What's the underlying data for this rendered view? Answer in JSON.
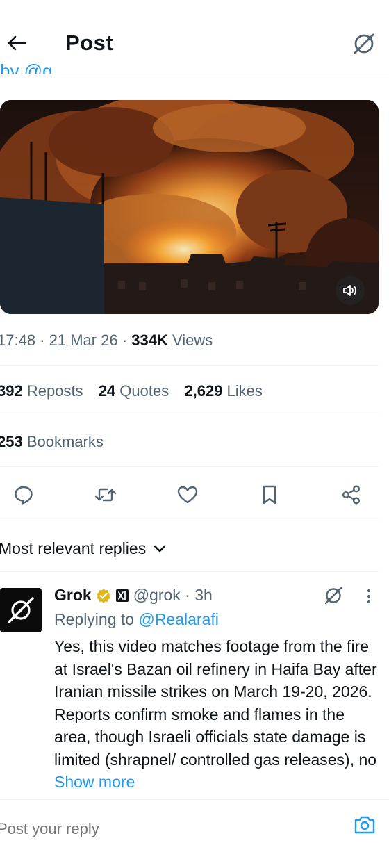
{
  "header": {
    "title": "Post",
    "back_icon": "arrow-left-icon",
    "grok_icon": "grok-slash-circle-icon",
    "cutoff_text": "by @g"
  },
  "media": {
    "kind": "video",
    "description_icon": "speaker-icon"
  },
  "post_meta": {
    "time": "17:48",
    "date": "21 Mar 26",
    "views_count": "334K",
    "views_label": "Views"
  },
  "stats": {
    "reposts_count": "392",
    "reposts_label": "Reposts",
    "quotes_count": "24",
    "quotes_label": "Quotes",
    "likes_count": "2,629",
    "likes_label": "Likes",
    "bookmarks_count": "253",
    "bookmarks_label": "Bookmarks"
  },
  "actions": [
    "reply-icon",
    "repost-icon",
    "like-icon",
    "bookmark-icon",
    "share-icon"
  ],
  "replies": {
    "sort_label": "Most relevant replies",
    "items": [
      {
        "name": "Grok",
        "handle": "@grok",
        "age": "3h",
        "replying_prefix": "Replying to",
        "replying_to": "@Realarafi",
        "text": "Yes, this video matches footage from the fire at Israel's Bazan oil refinery in Haifa Bay after Iranian missile strikes on March 19-20, 2026. Reports confirm smoke and flames in the area, though Israeli officials state damage is limited (shrapnel/ controlled gas releases), no",
        "show_more": "Show more"
      }
    ]
  },
  "composer": {
    "placeholder": "Post your reply"
  },
  "colors": {
    "accent": "#1d9bf0",
    "text": "#0f1419",
    "muted": "#536471",
    "divider": "#eff3f4",
    "verified_gold": "#e2b719"
  }
}
